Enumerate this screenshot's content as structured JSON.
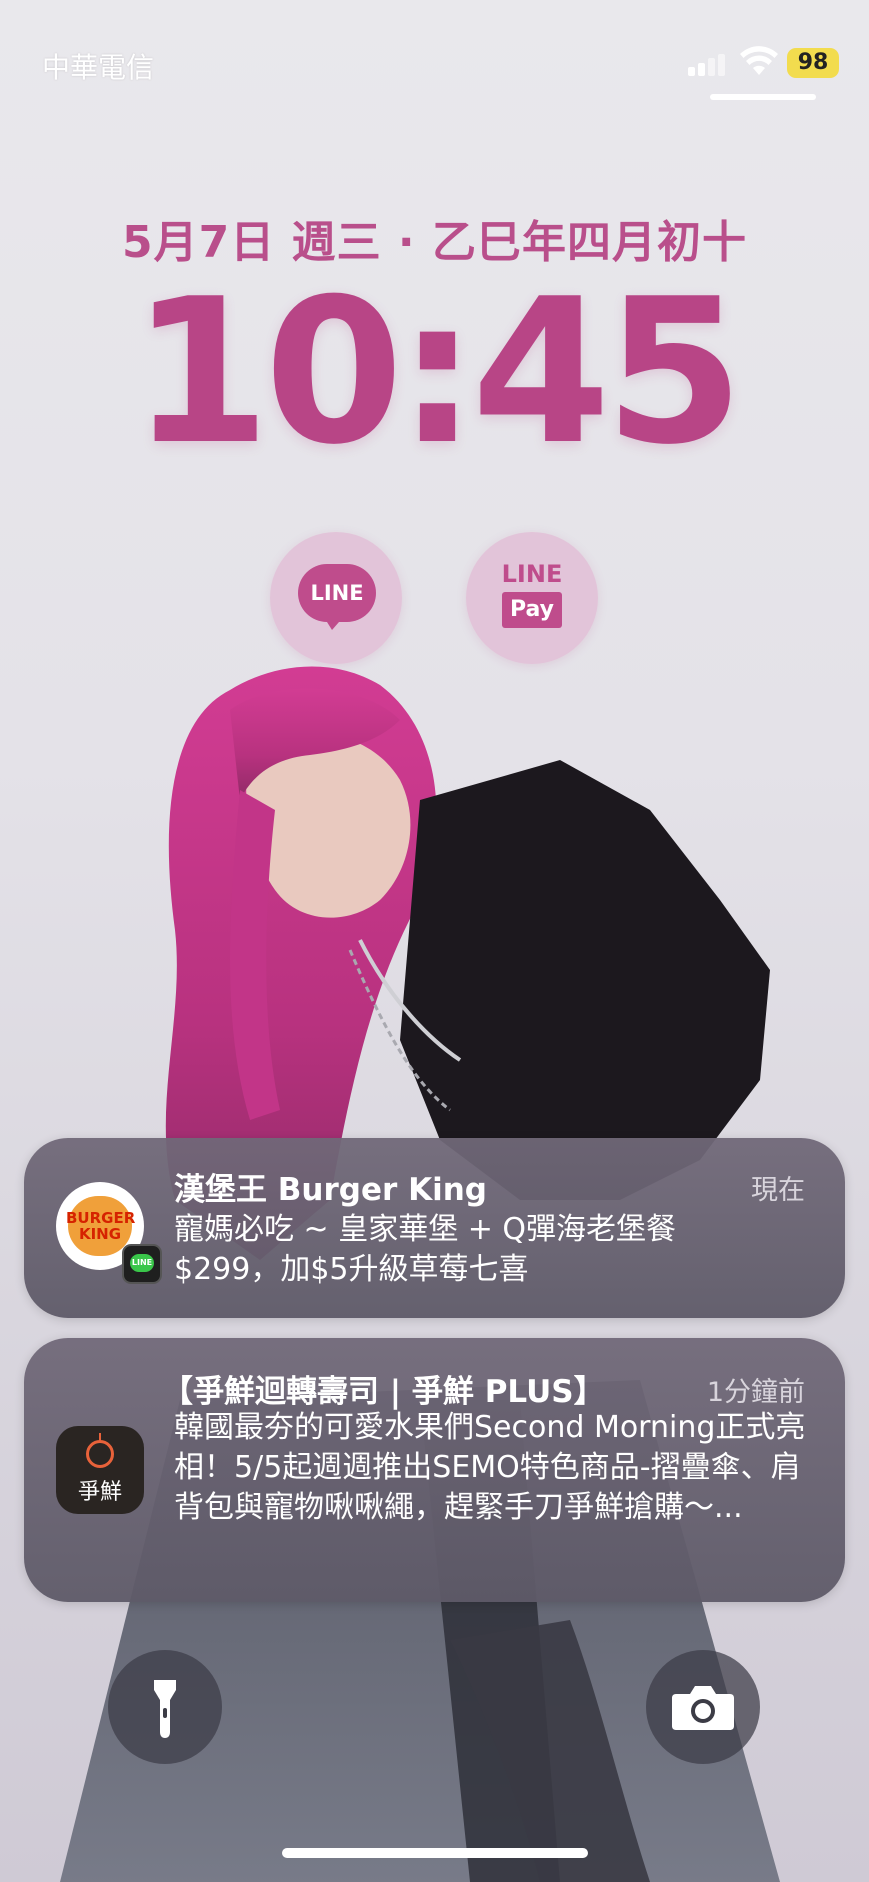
{
  "status_bar": {
    "carrier": "中華電信",
    "battery": "98",
    "icons": [
      "cellular-signal-icon",
      "wifi-icon",
      "battery-icon"
    ],
    "battery_color": "#f2dc4e"
  },
  "lockscreen": {
    "date": "5月7日 週三 · 乙巳年四月初十",
    "time": "10:45",
    "accent_color": "#b84586"
  },
  "widgets": [
    {
      "name": "LINE",
      "label": "LINE"
    },
    {
      "name": "LINE Pay",
      "label_top": "LINE",
      "label_bottom": "Pay"
    }
  ],
  "notifications": [
    {
      "app_icon": "burger-king-icon",
      "app_icon_text": "BURGER KING",
      "badge": "LINE",
      "title": "漢堡王 Burger King",
      "time": "現在",
      "body": "寵媽必吃 ~ 皇家華堡 + Q彈海老堡餐 $299，加$5升級草莓七喜"
    },
    {
      "app_icon": "sushi-app-icon",
      "app_icon_text": "爭鮮",
      "title": "【爭鮮迴轉壽司 | 爭鮮 PLUS】",
      "time": "1分鐘前",
      "body": "韓國最夯的可愛水果們Second Morning正式亮相！5/5起週週推出SEMO特色商品-摺疊傘、肩背包與寵物啾啾繩，趕緊手刀爭鮮搶購～..."
    }
  ],
  "quick_actions": [
    {
      "name": "flashlight",
      "icon": "flashlight-icon"
    },
    {
      "name": "camera",
      "icon": "camera-icon"
    }
  ]
}
